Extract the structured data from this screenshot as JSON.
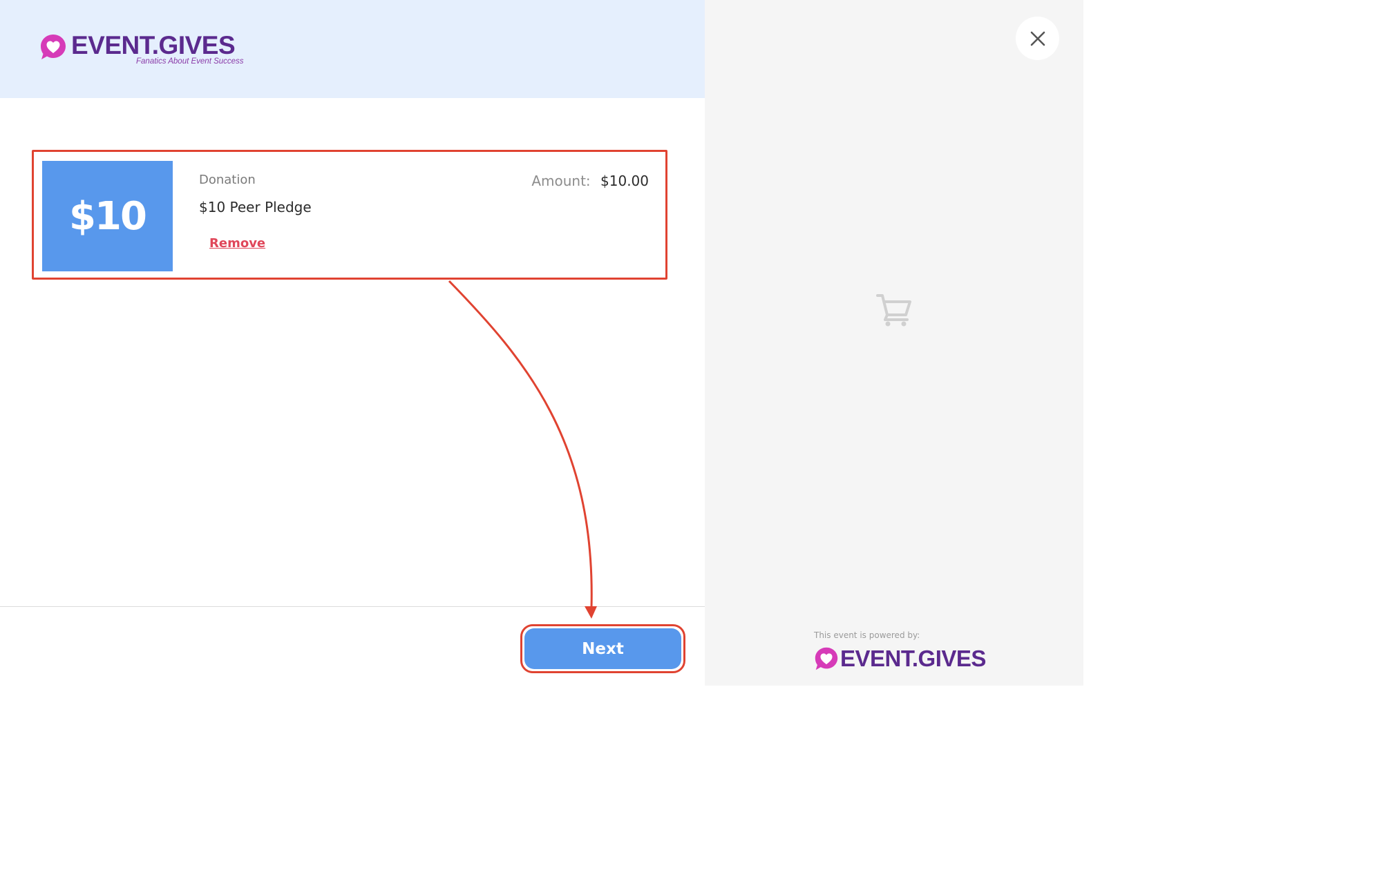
{
  "brand": {
    "name": "EVENT.GIVES",
    "tagline": "Fanatics About Event Success",
    "heart_color": "#d63bb8",
    "text_color": "#5b2a8e"
  },
  "cart": {
    "items": [
      {
        "thumb_label": "$10",
        "category": "Donation",
        "title": "$10 Peer Pledge",
        "remove_label": "Remove",
        "amount_label": "Amount:",
        "amount_value": "$10.00"
      }
    ]
  },
  "footer": {
    "next_label": "Next"
  },
  "sidebar": {
    "close_icon": "close-icon",
    "empty_cart_icon": "shopping-cart-icon",
    "powered_by_label": "This event is powered by:",
    "powered_by_brand": "EVENT.GIVES"
  },
  "colors": {
    "accent_blue": "#5898ec",
    "highlight_red": "#e04331",
    "remove_red": "#e0475a",
    "header_bg": "#e5effd",
    "sidebar_bg": "#f5f5f5"
  }
}
